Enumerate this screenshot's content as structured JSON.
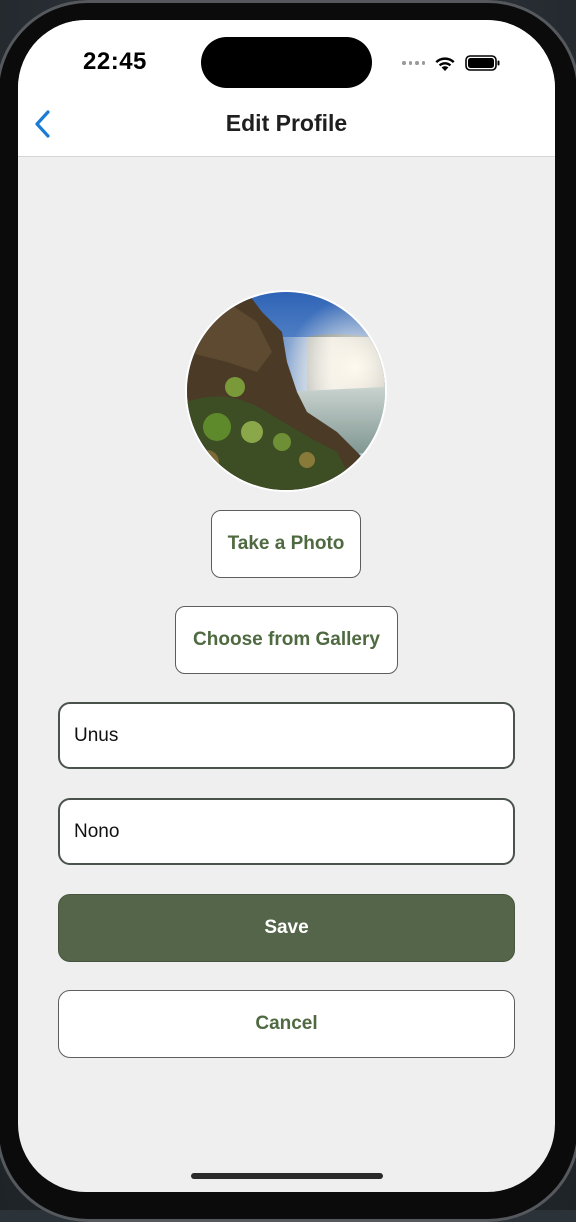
{
  "status_bar": {
    "time": "22:45",
    "icons": [
      "signal-dots-icon",
      "wifi-icon",
      "battery-icon"
    ]
  },
  "nav": {
    "back_icon": "chevron-left-icon",
    "title": "Edit Profile"
  },
  "profile": {
    "avatar": "waterfall-landscape-photo",
    "take_photo_label": "Take a Photo",
    "gallery_label": "Choose from Gallery"
  },
  "form": {
    "first_name_value": "Unus",
    "last_name_value": "Nono"
  },
  "actions": {
    "save_label": "Save",
    "cancel_label": "Cancel"
  },
  "colors": {
    "accent": "#546549",
    "accent_text": "#4f6a40",
    "back_arrow": "#1b7bd8",
    "background": "#efefef"
  }
}
